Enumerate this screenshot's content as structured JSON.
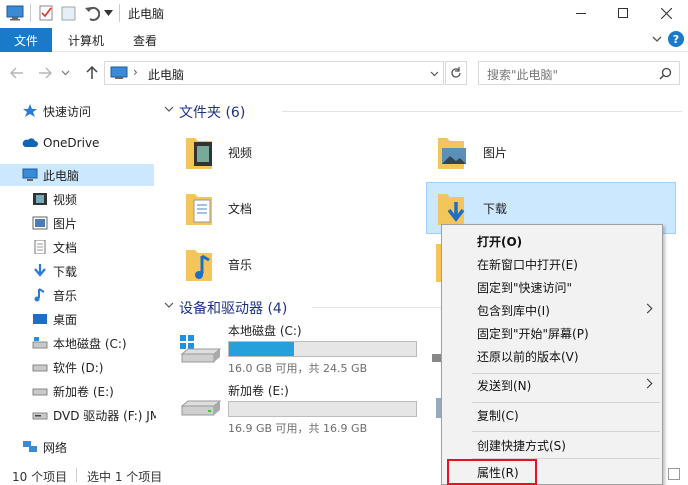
{
  "window": {
    "title": "此电脑"
  },
  "ribbon": {
    "tabs": [
      {
        "label": "文件"
      },
      {
        "label": "计算机"
      },
      {
        "label": "查看"
      }
    ]
  },
  "address": {
    "path": "此电脑",
    "search_placeholder": "搜索\"此电脑\""
  },
  "nav": {
    "items": [
      {
        "label": "快速访问",
        "icon": "star-icon"
      },
      {
        "label": "OneDrive",
        "icon": "cloud-icon"
      },
      {
        "label": "此电脑",
        "icon": "computer-icon"
      },
      {
        "label": "视频",
        "icon": "video-icon"
      },
      {
        "label": "图片",
        "icon": "picture-icon"
      },
      {
        "label": "文档",
        "icon": "document-icon"
      },
      {
        "label": "下载",
        "icon": "download-icon"
      },
      {
        "label": "音乐",
        "icon": "music-icon"
      },
      {
        "label": "桌面",
        "icon": "desktop-icon"
      },
      {
        "label": "本地磁盘 (C:)",
        "icon": "drive-c-icon"
      },
      {
        "label": "软件 (D:)",
        "icon": "drive-icon"
      },
      {
        "label": "新加卷 (E:)",
        "icon": "drive-icon"
      },
      {
        "label": "DVD 驱动器 (F:) JM",
        "icon": "dvd-icon"
      },
      {
        "label": "网络",
        "icon": "network-icon"
      }
    ]
  },
  "folders": {
    "header": "文件夹 (6)",
    "items": [
      {
        "label": "视频",
        "icon": "video-folder-icon"
      },
      {
        "label": "图片",
        "icon": "picture-folder-icon"
      },
      {
        "label": "文档",
        "icon": "document-folder-icon"
      },
      {
        "label": "下载",
        "icon": "download-folder-icon"
      },
      {
        "label": "音乐",
        "icon": "music-folder-icon"
      }
    ]
  },
  "drives": {
    "header": "设备和驱动器 (4)",
    "items": [
      {
        "label": "本地磁盘 (C:)",
        "detail": "16.0 GB 可用，共 24.5 GB",
        "fill": 0.35
      },
      {
        "label": "新加卷 (E:)",
        "detail": "16.9 GB 可用，共 16.9 GB",
        "fill": 0.0
      }
    ]
  },
  "status": {
    "count": "10 个项目",
    "selected": "选中 1 个项目"
  },
  "context_menu": {
    "items": [
      {
        "label": "打开(O)",
        "bold": true
      },
      {
        "label": "在新窗口中打开(E)"
      },
      {
        "label": "固定到\"快速访问\""
      },
      {
        "label": "包含到库中(I)"
      },
      {
        "label": "固定到\"开始\"屏幕(P)"
      },
      {
        "label": "还原以前的版本(V)"
      },
      {
        "label": "发送到(N)"
      },
      {
        "label": "复制(C)"
      },
      {
        "label": "创建快捷方式(S)"
      },
      {
        "label": "属性(R)"
      }
    ]
  },
  "colors": {
    "accent": "#1979ca",
    "selection": "#cce8ff",
    "highlight_border": "#e81123"
  }
}
